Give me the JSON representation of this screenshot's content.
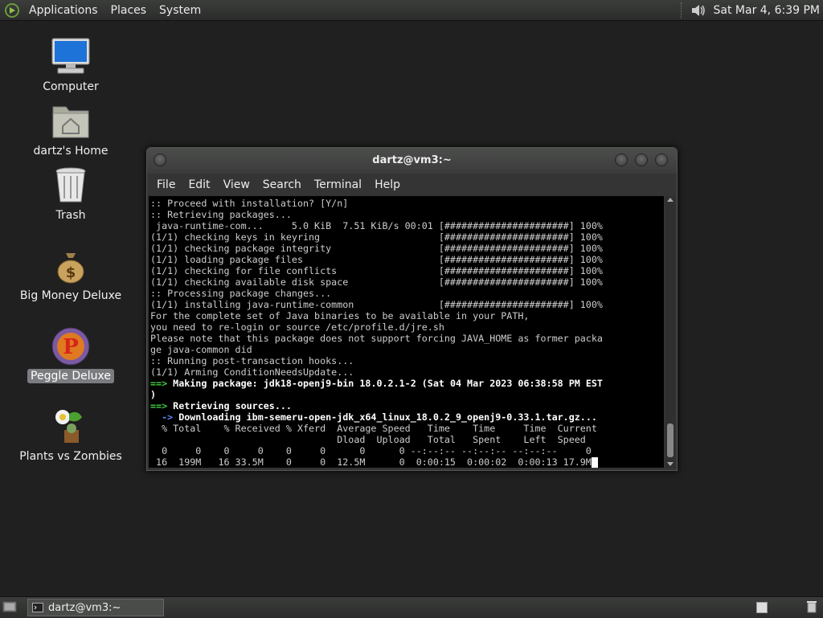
{
  "top_panel": {
    "menus": [
      "Applications",
      "Places",
      "System"
    ],
    "clock": "Sat Mar  4,  6:39 PM"
  },
  "desktop": {
    "icons": [
      {
        "label": "Computer",
        "icon": "computer-icon"
      },
      {
        "label": "dartz's Home",
        "icon": "home-folder-icon"
      },
      {
        "label": "Trash",
        "icon": "trash-icon"
      },
      {
        "label": "Big Money Deluxe",
        "icon": "money-bag-icon"
      },
      {
        "label": "Peggle Deluxe",
        "icon": "peggle-icon",
        "selected": true
      },
      {
        "label": "Plants vs Zombies",
        "icon": "plants-vs-zombies-icon"
      }
    ]
  },
  "terminal": {
    "title": "dartz@vm3:~",
    "menu": [
      "File",
      "Edit",
      "View",
      "Search",
      "Terminal",
      "Help"
    ],
    "lines": [
      ":: Proceed with installation? [Y/n]",
      ":: Retrieving packages...",
      " java-runtime-com...     5.0 KiB  7.51 KiB/s 00:01 [######################] 100%",
      "(1/1) checking keys in keyring                     [######################] 100%",
      "(1/1) checking package integrity                   [######################] 100%",
      "(1/1) loading package files                        [######################] 100%",
      "(1/1) checking for file conflicts                  [######################] 100%",
      "(1/1) checking available disk space                [######################] 100%",
      ":: Processing package changes...",
      "(1/1) installing java-runtime-common               [######################] 100%",
      "For the complete set of Java binaries to be available in your PATH,",
      "you need to re-login or source /etc/profile.d/jre.sh",
      "Please note that this package does not support forcing JAVA_HOME as former packa",
      "ge java-common did",
      ":: Running post-transaction hooks...",
      "(1/1) Arming ConditionNeedsUpdate..."
    ],
    "making_arrow": "==>",
    "making_text": " Making package: jdk18-openj9-bin 18.0.2.1-2 (Sat 04 Mar 2023 06:38:58 PM EST",
    "making_cont": ")",
    "retrieving_arrow": "==>",
    "retrieving_text": " Retrieving sources...",
    "download_arrow": "  ->",
    "download_text": " Downloading ibm-semeru-open-jdk_x64_linux_18.0.2_9_openj9-0.33.1.tar.gz...",
    "curl_header_1": "  % Total    % Received % Xferd  Average Speed   Time    Time     Time  Current",
    "curl_header_2": "                                 Dload  Upload   Total   Spent    Left  Speed",
    "curl_row_1": "  0     0    0     0    0     0      0      0 --:--:-- --:--:-- --:--:--     0",
    "curl_row_2": " 16  199M   16 33.5M    0     0  12.5M      0  0:00:15  0:00:02  0:00:13 17.9M"
  },
  "taskbar": {
    "task_label": "dartz@vm3:~"
  }
}
